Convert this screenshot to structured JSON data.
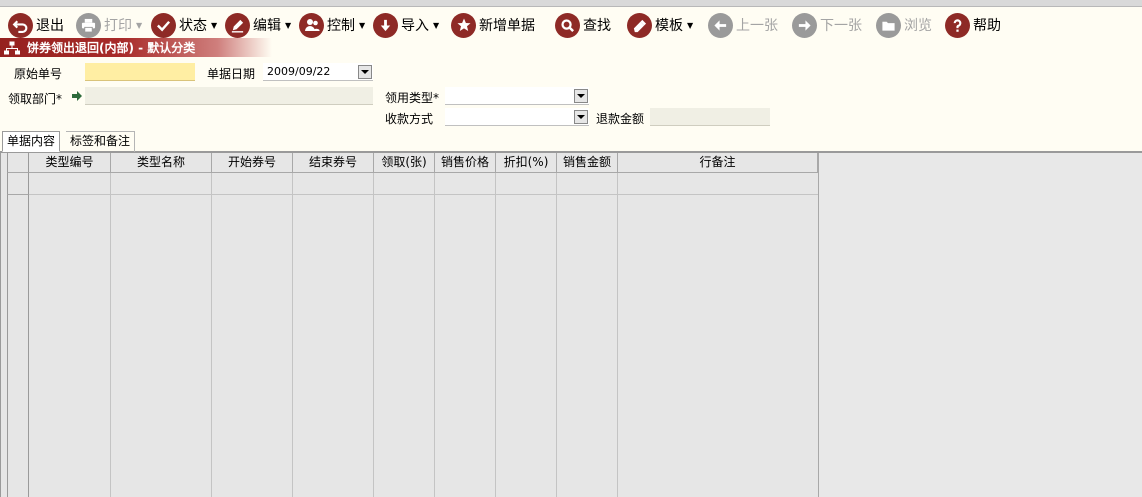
{
  "toolbar": {
    "exit": "退出",
    "print": "打印",
    "status": "状态",
    "edit": "编辑",
    "control": "控制",
    "import": "导入",
    "new_doc": "新增单据",
    "search": "查找",
    "template": "模板",
    "prev": "上一张",
    "next": "下一张",
    "browse": "浏览",
    "help": "帮助"
  },
  "title": "饼券领出退回(内部) - 默认分类",
  "form": {
    "orig_no_label": "原始单号",
    "orig_no_value": "",
    "doc_date_label": "单据日期",
    "doc_date_value": "2009/09/22",
    "dept_label": "领取部门*",
    "dept_value": "",
    "use_type_label": "领用类型*",
    "use_type_value": "",
    "pay_method_label": "收款方式",
    "pay_method_value": "",
    "refund_label": "退款金额",
    "refund_value": ""
  },
  "tabs": {
    "content": "单据内容",
    "tags": "标签和备注"
  },
  "grid": {
    "columns": [
      "类型编号",
      "类型名称",
      "开始券号",
      "结束券号",
      "领取(张)",
      "销售价格",
      "折扣(%)",
      "销售金额",
      "行备注"
    ],
    "rows": []
  }
}
